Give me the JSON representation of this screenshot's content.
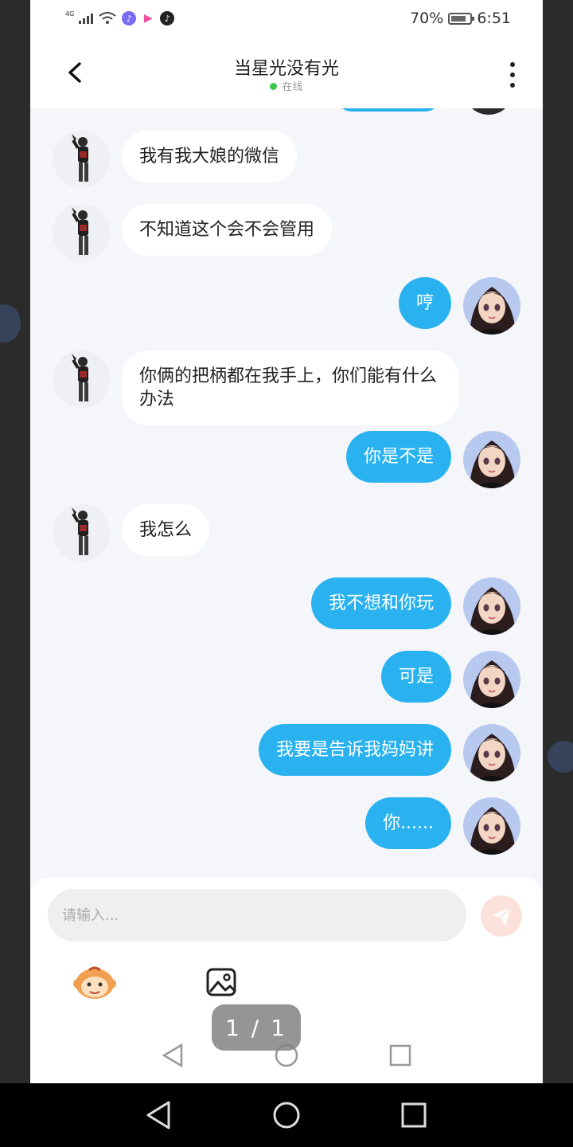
{
  "status_bar": {
    "network": "4G",
    "battery": "70%",
    "time": "6:51",
    "icons": [
      "signal-icon",
      "wifi-icon",
      "music-app-icon",
      "video-app-icon",
      "tiktok-icon",
      "battery-icon"
    ]
  },
  "header": {
    "title": "当星光没有光",
    "status": "在线",
    "back_icon": "chevron-left-icon",
    "more_icon": "more-vertical-icon"
  },
  "messages": [
    {
      "side": "left",
      "text": "我有我大娘的微信"
    },
    {
      "side": "left",
      "text": "不知道这个会不会管用"
    },
    {
      "side": "right",
      "text": "哼"
    },
    {
      "side": "left",
      "text": "你俩的把柄都在我手上，你们能有什么办法"
    },
    {
      "side": "right",
      "text": "你是不是"
    },
    {
      "side": "left",
      "text": "我怎么"
    },
    {
      "side": "right",
      "text": "我不想和你玩"
    },
    {
      "side": "right",
      "text": "可是"
    },
    {
      "side": "right",
      "text": "我要是告诉我妈妈讲"
    },
    {
      "side": "right",
      "text": "你......"
    }
  ],
  "composer": {
    "placeholder": "请输入...",
    "value": "",
    "send_icon": "send-icon",
    "emoji_icon": "monkey-emoji-icon",
    "image_icon": "image-icon"
  },
  "page_indicator": "1 / 1",
  "colors": {
    "accent": "#29b2ef",
    "chat_bg": "#f4f6f9",
    "online": "#3cc84a",
    "send_button": "#fde2dc"
  }
}
